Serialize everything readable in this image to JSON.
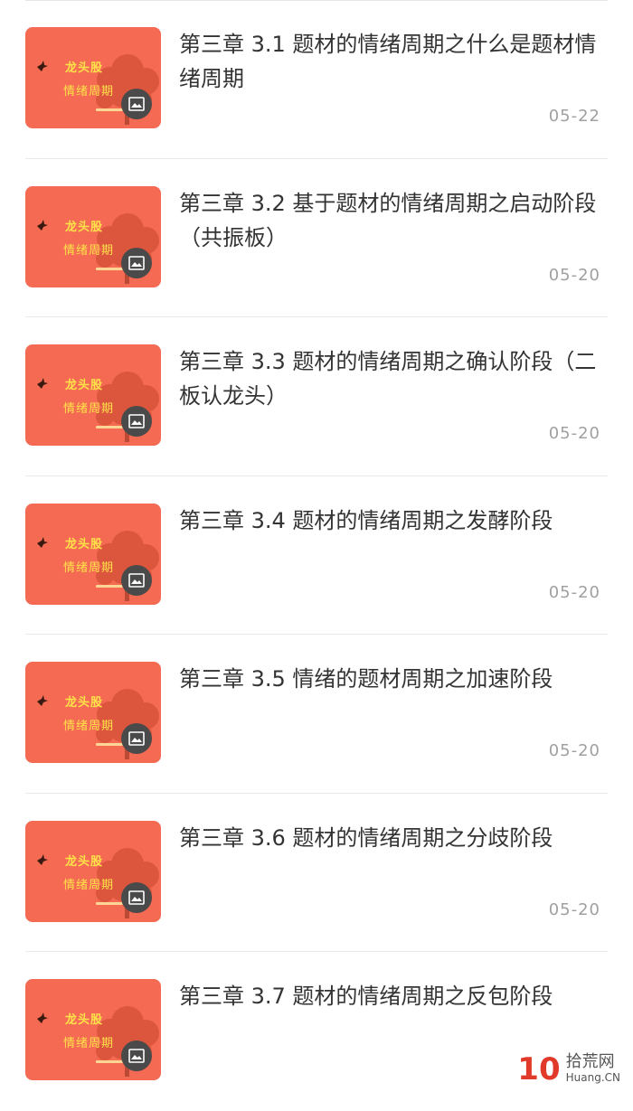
{
  "articles": [
    {
      "title": "第三章 3.1 题材的情绪周期之什么是题材情绪周期",
      "date": "05-22",
      "thumb_text_1": "龙头股",
      "thumb_text_2": "情绪周期"
    },
    {
      "title": "第三章 3.2 基于题材的情绪周期之启动阶段（共振板）",
      "date": "05-20",
      "thumb_text_1": "龙头股",
      "thumb_text_2": "情绪周期"
    },
    {
      "title": "第三章 3.3 题材的情绪周期之确认阶段（二板认龙头）",
      "date": "05-20",
      "thumb_text_1": "龙头股",
      "thumb_text_2": "情绪周期"
    },
    {
      "title": "第三章 3.4 题材的情绪周期之发酵阶段",
      "date": "05-20",
      "thumb_text_1": "龙头股",
      "thumb_text_2": "情绪周期"
    },
    {
      "title": "第三章 3.5 情绪的题材周期之加速阶段",
      "date": "05-20",
      "thumb_text_1": "龙头股",
      "thumb_text_2": "情绪周期"
    },
    {
      "title": "第三章 3.6 题材的情绪周期之分歧阶段",
      "date": "05-20",
      "thumb_text_1": "龙头股",
      "thumb_text_2": "情绪周期"
    },
    {
      "title": "第三章 3.7 题材的情绪周期之反包阶段",
      "date": "",
      "thumb_text_1": "龙头股",
      "thumb_text_2": "情绪周期"
    }
  ],
  "watermark": {
    "number": "10",
    "name": "拾荒网",
    "domain": "Huang.CN"
  },
  "colors": {
    "thumb_bg": "#f46a52",
    "thumb_text": "#ffe24a",
    "title_text": "#333333",
    "date_text": "#a0a0a0",
    "watermark_red": "#e23a2a"
  },
  "icons": {
    "thumb_badge": "image-icon",
    "thumb_bird": "bird-icon"
  }
}
